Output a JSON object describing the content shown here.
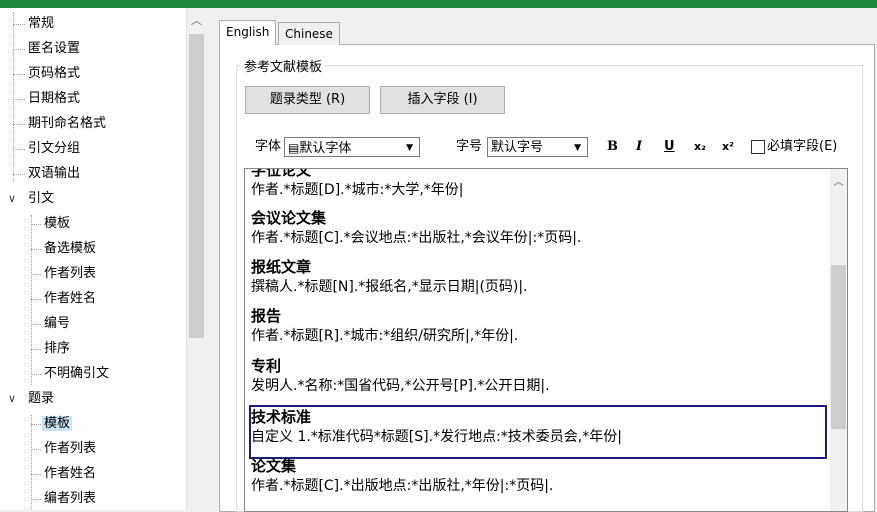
{
  "tree": {
    "items": [
      {
        "label": "常规"
      },
      {
        "label": "匿名设置"
      },
      {
        "label": "页码格式"
      },
      {
        "label": "日期格式"
      },
      {
        "label": "期刊命名格式"
      },
      {
        "label": "引文分组"
      },
      {
        "label": "双语输出"
      },
      {
        "label": "引文"
      },
      {
        "label": "模板"
      },
      {
        "label": "备选模板"
      },
      {
        "label": "作者列表"
      },
      {
        "label": "作者姓名"
      },
      {
        "label": "编号"
      },
      {
        "label": "排序"
      },
      {
        "label": "不明确引文"
      },
      {
        "label": "题录"
      },
      {
        "label": "模板"
      },
      {
        "label": "作者列表"
      },
      {
        "label": "作者姓名"
      },
      {
        "label": "编者列表"
      }
    ],
    "selected_index": 16
  },
  "tabs": [
    {
      "label": "English"
    },
    {
      "label": "Chinese"
    }
  ],
  "group": {
    "title": "参考文献模板",
    "ref_type_button": "题录类型 (R)",
    "insert_field_button": "插入字段 (I)"
  },
  "format_bar": {
    "font_label": "字体",
    "font_value": "默认字体",
    "size_label": "字号",
    "size_value": "默认字号",
    "bold": "B",
    "italic": "I",
    "underline": "U",
    "subscript": "x₂",
    "superscript": "x²",
    "required_label": "必填字段(E)"
  },
  "entries": [
    {
      "title": "学位论文",
      "template": "作者.*标题[D].*城市:*大学,*年份|"
    },
    {
      "title": "会议论文集",
      "template": "作者.*标题[C].*会议地点:*出版社,*会议年份|:*页码|."
    },
    {
      "title": "报纸文章",
      "template": "撰稿人.*标题[N].*报纸名,*显示日期|(页码)|."
    },
    {
      "title": "报告",
      "template": "作者.*标题[R].*城市:*组织/研究所|,*年份|."
    },
    {
      "title": "专利",
      "template": "发明人.*名称:*国省代码,*公开号[P].*公开日期|."
    },
    {
      "title": "技术标准",
      "template": "自定义 1.*标准代码*标题[S].*发行地点:*技术委员会,*年份|"
    },
    {
      "title": "论文集",
      "template": "作者.*标题[C].*出版地点:*出版社,*年份|:*页码|."
    }
  ]
}
